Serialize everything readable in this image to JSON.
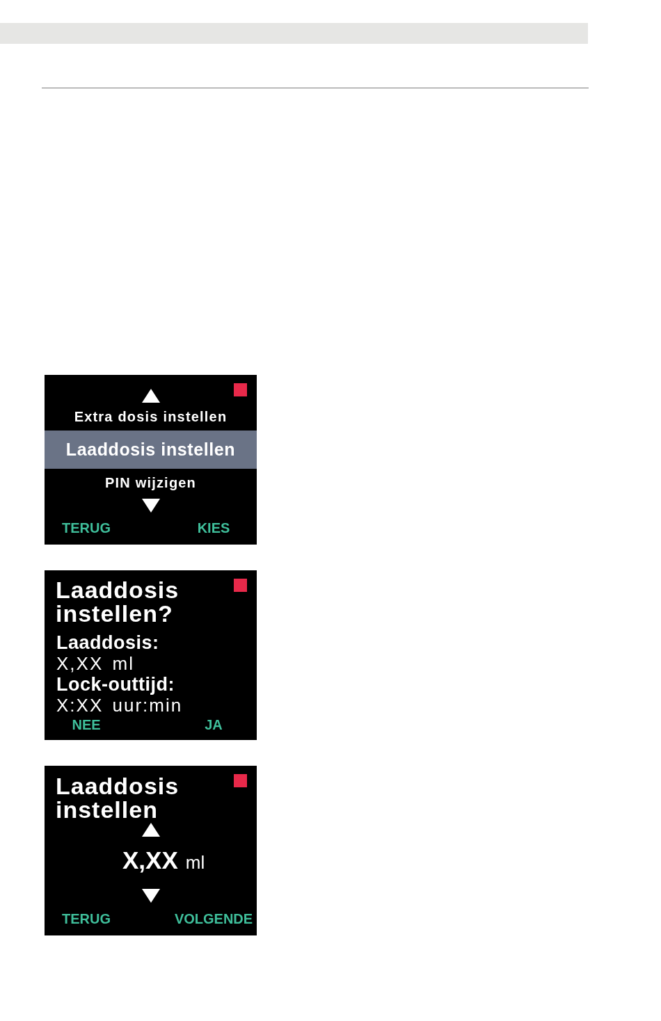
{
  "screens": [
    {
      "kind": "menu",
      "items": [
        {
          "label": "Extra dosis instellen",
          "selected": false
        },
        {
          "label": "Laaddosis instellen",
          "selected": true
        },
        {
          "label": "PIN wijzigen",
          "selected": false
        }
      ],
      "softkeys": [
        "TERUG",
        "KIES"
      ]
    },
    {
      "kind": "confirm",
      "title": "Laaddosis instellen?",
      "fields": [
        {
          "label": "Laaddosis:",
          "value": "X,XX ml"
        },
        {
          "label": "Lock-outtijd:",
          "value": "X:XX uur:min"
        }
      ],
      "softkeys": [
        "NEE",
        "JA"
      ]
    },
    {
      "kind": "value",
      "title": "Laaddosis instellen",
      "value": "X,XX",
      "unit": "ml",
      "softkeys": [
        "TERUG",
        "VOLGENDE"
      ]
    }
  ]
}
